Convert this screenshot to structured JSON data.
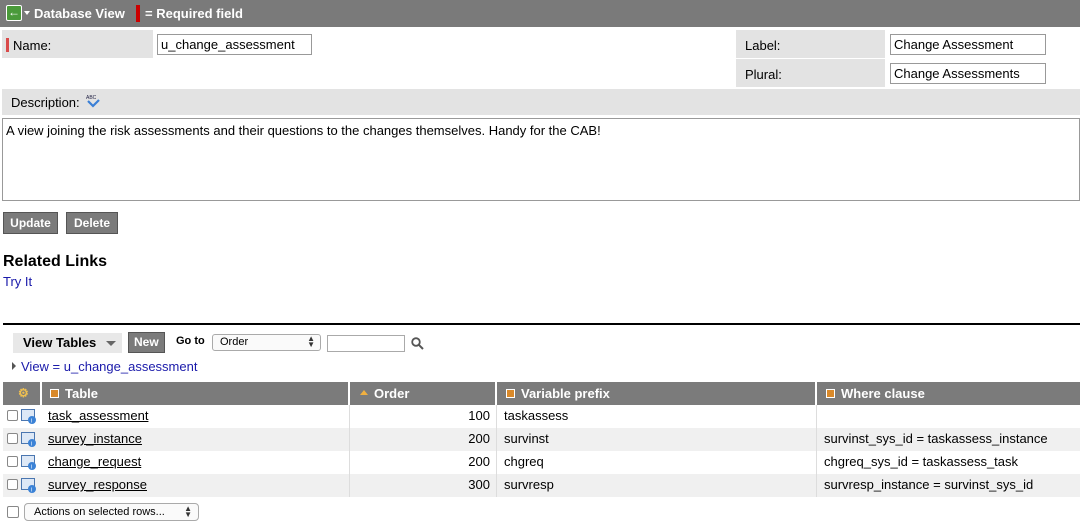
{
  "header": {
    "title": "Database View",
    "required_note": "= Required field"
  },
  "form": {
    "name_label": "Name:",
    "name_value": "u_change_assessment",
    "label_label": "Label:",
    "label_value": "Change Assessment",
    "plural_label": "Plural:",
    "plural_value": "Change Assessments",
    "description_label": "Description:",
    "description_value": "A view joining the risk assessments and their questions to the changes themselves. Handy for the CAB!"
  },
  "buttons": {
    "update": "Update",
    "delete": "Delete"
  },
  "related": {
    "title": "Related Links",
    "try_it": "Try It"
  },
  "list": {
    "view_tables": "View Tables",
    "new": "New",
    "goto": "Go to",
    "goto_selected": "Order",
    "breadcrumb": "View = u_change_assessment",
    "columns": [
      "Table",
      "Order",
      "Variable prefix",
      "Where clause"
    ],
    "rows": [
      {
        "table": "task_assessment",
        "order": "100",
        "prefix": "taskassess",
        "where": ""
      },
      {
        "table": "survey_instance",
        "order": "200",
        "prefix": "survinst",
        "where": "survinst_sys_id = taskassess_instance"
      },
      {
        "table": "change_request",
        "order": "200",
        "prefix": "chgreq",
        "where": "chgreq_sys_id = taskassess_task"
      },
      {
        "table": "survey_response",
        "order": "300",
        "prefix": "survresp",
        "where": "survresp_instance = survinst_sys_id"
      }
    ],
    "actions": "Actions on selected rows..."
  },
  "colors": {
    "header_bg": "#7a7a7a",
    "label_bg": "#e3e3e3",
    "required": "#cc0000",
    "link": "#1a1aaa"
  }
}
